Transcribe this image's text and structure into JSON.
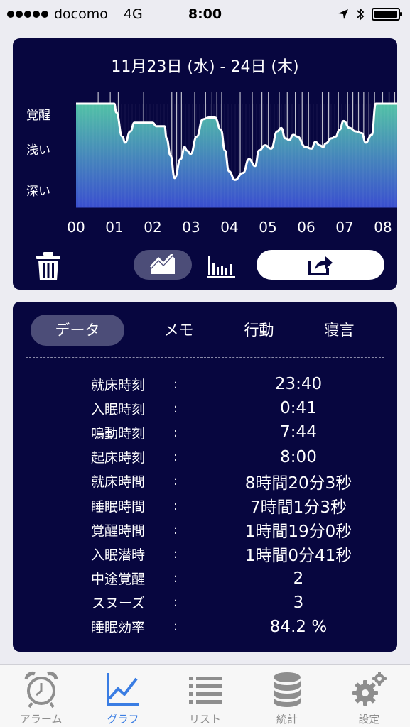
{
  "status_bar": {
    "carrier": "docomo",
    "network": "4G",
    "time": "8:00"
  },
  "graph": {
    "date_range": "11月23日 (水) - 24日 (木)",
    "depth_labels": [
      "覚醒",
      "浅い",
      "深い"
    ],
    "hour_labels": [
      "00",
      "01",
      "02",
      "03",
      "04",
      "05",
      "06",
      "07",
      "08"
    ],
    "colors": {
      "fill_top": "#52c2a6",
      "fill_bottom": "#3a4fcf",
      "line": "#ffffff"
    }
  },
  "chart_data": {
    "type": "area",
    "ylabels": [
      "覚醒",
      "浅い",
      "深い"
    ],
    "x_ticks": [
      "00",
      "01",
      "02",
      "03",
      "04",
      "05",
      "06",
      "07",
      "08"
    ],
    "ylim": [
      0,
      1
    ],
    "series": [
      {
        "x": [
          0,
          0.95,
          1.0,
          1.15,
          1.22,
          1.35,
          1.45,
          1.9,
          2.0,
          2.2,
          2.25,
          2.35,
          2.45,
          2.6,
          2.7,
          2.75,
          2.85,
          3.0,
          3.15,
          3.3,
          3.45,
          3.6,
          3.7,
          3.8,
          3.95,
          4.15,
          4.3,
          4.45,
          4.55,
          4.7,
          4.85,
          5.0,
          5.1,
          5.2,
          5.3,
          5.4,
          5.5,
          5.7,
          5.85,
          5.95,
          6.05,
          6.15,
          6.2,
          6.35,
          6.45,
          6.55,
          6.65,
          6.8,
          6.95,
          7.1,
          7.2,
          7.35,
          7.45,
          7.58,
          7.72,
          7.85,
          8.0
        ],
        "values": [
          1.0,
          1.0,
          0.9,
          0.62,
          0.55,
          0.68,
          0.78,
          0.78,
          0.74,
          0.74,
          0.6,
          0.4,
          0.14,
          0.36,
          0.5,
          0.46,
          0.42,
          0.62,
          0.82,
          0.84,
          0.84,
          0.7,
          0.46,
          0.22,
          0.12,
          0.2,
          0.36,
          0.28,
          0.46,
          0.52,
          0.48,
          0.68,
          0.72,
          0.6,
          0.58,
          0.64,
          0.62,
          0.5,
          0.48,
          0.56,
          0.52,
          0.5,
          0.54,
          0.6,
          0.62,
          0.7,
          0.8,
          0.72,
          0.68,
          0.66,
          0.55,
          0.64,
          1.0,
          1.0,
          1.0,
          1.0,
          1.0
        ]
      }
    ],
    "spikes_x": [
      0.55,
      0.85,
      1.05,
      1.68,
      2.38,
      2.5,
      2.62,
      2.95,
      3.22,
      3.38,
      3.5,
      3.62,
      4.08,
      4.38,
      4.62,
      4.78,
      5.05,
      5.25,
      5.45,
      5.62,
      5.78,
      6.12,
      6.28,
      6.52,
      6.75,
      6.88,
      7.02,
      7.15,
      7.28,
      7.42,
      7.62,
      7.78,
      7.92
    ]
  },
  "data_panel": {
    "tabs": [
      "データ",
      "メモ",
      "行動",
      "寝言"
    ],
    "stats": [
      {
        "label": "就床時刻",
        "value": "23:40"
      },
      {
        "label": "入眠時刻",
        "value": "0:41"
      },
      {
        "label": "鳴動時刻",
        "value": "7:44"
      },
      {
        "label": "起床時刻",
        "value": "8:00"
      },
      {
        "label": "就床時間",
        "value": "8時間20分3秒"
      },
      {
        "label": "睡眠時間",
        "value": "7時間1分3秒"
      },
      {
        "label": "覚醒時間",
        "value": "1時間19分0秒"
      },
      {
        "label": "入眠潜時",
        "value": "1時間0分41秒"
      },
      {
        "label": "中途覚醒",
        "value": "2"
      },
      {
        "label": "スヌーズ",
        "value": "3"
      },
      {
        "label": "睡眠効率",
        "value": "84.2 %"
      }
    ],
    "colon": ":"
  },
  "tab_bar": {
    "items": [
      {
        "label": "アラーム",
        "icon": "alarm-clock-icon"
      },
      {
        "label": "グラフ",
        "icon": "line-chart-icon"
      },
      {
        "label": "リスト",
        "icon": "list-icon"
      },
      {
        "label": "統計",
        "icon": "database-icon"
      },
      {
        "label": "設定",
        "icon": "gear-icon"
      }
    ],
    "active_color": "#3a7de3",
    "inactive_color": "#8e8e8e"
  }
}
